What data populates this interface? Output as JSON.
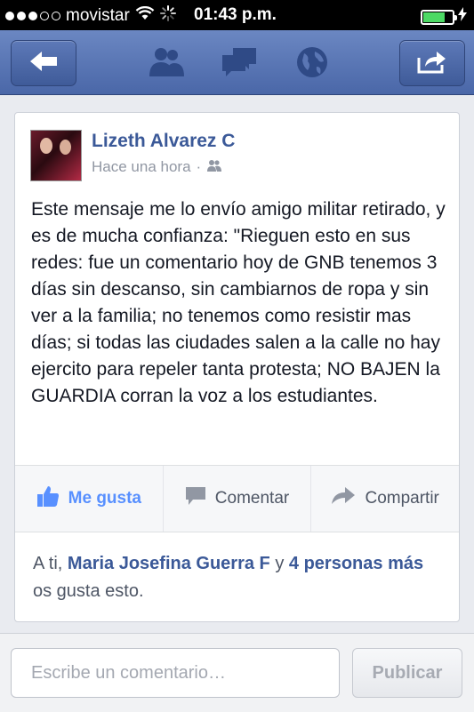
{
  "status_bar": {
    "carrier": "movistar",
    "time": "01:43 p.m.",
    "battery_level": 0.75,
    "battery_color": "#4cd964",
    "icons": [
      "signal-dots-icon",
      "wifi-icon",
      "activity-spinner-icon",
      "battery-icon",
      "charging-bolt-icon"
    ]
  },
  "nav_bar": {
    "back_icon": "back-arrow-icon",
    "center_icons": [
      "friend-requests-icon",
      "messages-icon",
      "notifications-globe-icon"
    ],
    "share_icon": "share-icon"
  },
  "post": {
    "author": "Lizeth Alvarez C",
    "time": "Hace una hora",
    "separator": "·",
    "privacy_icon": "friends-icon",
    "text": "Este mensaje me lo envío amigo militar retirado, y es de mucha confianza: \"Rieguen esto en sus redes: fue un comentario hoy de GNB tenemos 3 días sin descanso, sin cambiarnos de ropa y sin ver a la familia; no tenemos como resistir mas días; si todas las ciudades salen a la calle no hay ejercito para repeler tanta protesta; NO BAJEN la GUARDIA corran la voz a los estudiantes.",
    "actions": {
      "like": "Me gusta",
      "comment": "Comentar",
      "share": "Compartir"
    },
    "likes": {
      "prefix": "A ti, ",
      "person": "Maria Josefina Guerra F",
      "conjunction": " y ",
      "others": "4 personas más",
      "suffix": " os gusta esto."
    }
  },
  "comment_bar": {
    "placeholder": "Escribe un comentario…",
    "publish_label": "Publicar"
  },
  "colors": {
    "brand_blue": "#3b5998",
    "liked_blue": "#5890ff",
    "navbar_top": "#6b87c2",
    "navbar_bottom": "#4a67a8"
  }
}
